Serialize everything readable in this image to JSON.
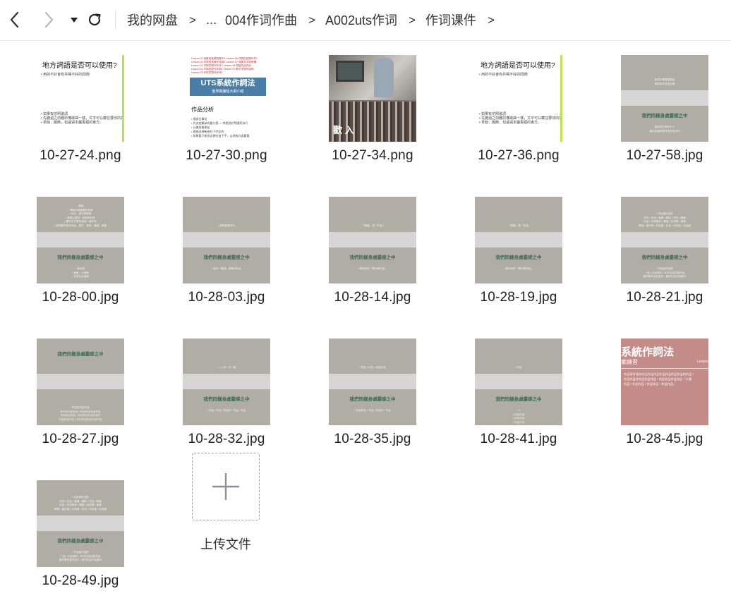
{
  "breadcrumb": {
    "items": [
      "我的网盘",
      "...",
      "004作词作曲",
      "A002uts作词",
      "作词课件"
    ],
    "separator": ">"
  },
  "files": [
    {
      "name": "10-27-24.png",
      "thumb": "slide",
      "title": "地方詞語是否可以使用?",
      "lines": [
        "• 用的不好會有共鳴不好的問題!",
        "• 如果有仿照歌詞",
        "  • 先聽過之前難的懂歌曲一樣，文字可以藏住要非的意思。",
        "  • 茶館，服飾，包遍週本屬風裡的東方。"
      ]
    },
    {
      "name": "10-27-30.png",
      "thumb": "uts",
      "red_lines": [
        "Lesson 01 為數的音樂詞音作1  Lesson 06 作詞的音樂作作2",
        "Lesson 02 作詞的音樂作作用2  Lesson 07 深層文字詞音構",
        "Lesson 03 字詞的詞作作作2  Lesson 08 詞彙作品作說",
        "Lesson 04 作詞的詞作作詞1  Lesson 09 歌中字詞作說詞",
        "Lesson 05 作詞的詞作作作1"
      ],
      "banner_title": "UTS系統作詞法",
      "banner_sub": "整學期課程大綱介紹",
      "section": "作品分析",
      "lines": [
        "• 描述出事出",
        "• 先決定類似的要什麼 -> 考慮對於等國家技巧",
        "• 以後找後朋友",
        "  • 歌曲出現新曲目下完全的",
        "  • 如果要下新思念想在這下手，以地為方面看看"
      ]
    },
    {
      "name": "10-27-34.png",
      "thumb": "photo",
      "caption": "歡 入"
    },
    {
      "name": "10-27-36.png",
      "thumb": "slide",
      "title": "地方詞語是否可以使用?",
      "lines": [
        "• 用的不好會有共鳴不好的問題!",
        "• 如果有仿照歌詞",
        "  • 先聽過之前難的懂歌曲一樣，文字可以藏住要非的意思。",
        "  • 茶館，服飾，包遍週本屬風裡的東方。"
      ]
    },
    {
      "name": "10-27-58.jpg",
      "thumb": "gray",
      "green": "我們同樣身處靈感之中",
      "green_pos": "low",
      "top_lines": [
        "我們不需要被限制",
        "獨寫者作品的目標"
      ],
      "bottom_lines": [
        "讓我們去寫作中介",
        "讓作品獲得寫作的作品中的"
      ]
    },
    {
      "name": "10-28-00.jpg",
      "thumb": "gray",
      "green": "我們同樣身處靈感之中",
      "green_pos": "low",
      "top_lines": [
        "• 開始",
        "• 開始的是都要你來過",
        "• 作品，是在哪裡寫",
        "• 要是主題在一個用到作品",
        "• 要在作什麼作品做一個作品",
        "• 我們要去寫作作品，是在、畫畫、轉換、轉變"
      ],
      "bottom_lines": [
        "• 給你說",
        "• 畫畫、什麼畫",
        "• 完成作品畫畫"
      ]
    },
    {
      "name": "10-28-03.jpg",
      "thumb": "gray",
      "green": "我們同樣身處靈感之中",
      "green_pos": "low",
      "top_lines": [
        "• 我們要寫的句"
      ],
      "bottom_lines": [
        "• 給你「看見」都寫作作品"
      ]
    },
    {
      "name": "10-28-14.jpg",
      "thumb": "gray",
      "green": "我們同樣身處靈感之中",
      "green_pos": "low",
      "top_lines": [
        "• 「寫著」是「作品」"
      ],
      "bottom_lines": [
        "• 寫作品的「寫作寫作品」"
      ]
    },
    {
      "name": "10-28-19.jpg",
      "thumb": "gray",
      "green": "我們同樣身處靈感之中",
      "green_pos": "low",
      "top_lines": [
        "• 「寫著」是「作品」"
      ],
      "bottom_lines": [
        "• 寫作品的「寫作寫作品」"
      ]
    },
    {
      "name": "10-28-21.jpg",
      "thumb": "gray",
      "green": "我們同樣身處靈感之中",
      "green_pos": "low",
      "top_lines": [
        "• 作品與作品的",
        "完成 • 作品 • 畫畫 • 轉換 • 作品 • 轉變",
        "作品 • 作品畫作 • 轉換 • 完成畫 • 畫畫",
        "轉換 • 畫作畫 • 作品畫 • 作品 • 作品畫 • 完成畫"
      ],
      "bottom_lines": [
        "• 作品給作品的",
        "一個 • 作品寫作 • 作作作品的寫作品",
        "要作寫作品作品作 • 寫作作品作品畫作"
      ]
    },
    {
      "name": "10-28-27.jpg",
      "thumb": "gray",
      "green": "我們同樣身處靈感之中",
      "green_pos": "high",
      "top_lines": [],
      "bottom_lines": [
        "作品的作品作品",
        "作作作作品作品 • 作品作品作品作品",
        "作品作品作品 • 作品作品作品作品作",
        "作品作品作品 • 作作作品作品作品作品"
      ]
    },
    {
      "name": "10-28-32.jpg",
      "thumb": "gray",
      "green": "我們同樣身處靈感之中",
      "green_pos": "low",
      "top_lines": [
        "• 人 • 作 • 作 • 轉"
      ],
      "bottom_lines": [
        "• 作品 • 作品 • 作品作 • 作品 • 作品"
      ]
    },
    {
      "name": "10-28-35.jpg",
      "thumb": "gray",
      "green": "我們同樣身處靈感之中",
      "green_pos": "low",
      "top_lines": [
        "• 作品 • 作品 • 作品作品"
      ],
      "bottom_lines": [
        "• 作品作品 • 作品 • 作品作 • 作品"
      ]
    },
    {
      "name": "10-28-41.jpg",
      "thumb": "gray",
      "green": "我們同樣身處靈感之中",
      "green_pos": "low",
      "top_lines": [
        "• 作品"
      ],
      "bottom_lines": [
        "• 人",
        "• 作品作品",
        "• 作品作品",
        "• 作品作品"
      ]
    },
    {
      "name": "10-28-45.jpg",
      "thumb": "pink",
      "title": "系統作詞法",
      "subtitle": "案練習",
      "lesson": "Lesson",
      "lines": [
        "作品寫作寫作作品作品作品作品作品作品作品的作品 •",
        "作品作品作作品作品作品 • 作品作品作品作品「人類",
        "作品 • 作品作品 • 作品作品 • 作品作品」"
      ]
    },
    {
      "name": "10-28-49.jpg",
      "thumb": "gray",
      "green": "我們同樣身處靈感之中",
      "green_pos": "low",
      "top_lines": [
        "• 作品與作品的",
        "完成 • 作品 • 畫畫 • 轉換 • 作品 • 轉變",
        "作品 • 作品畫作 • 轉換 • 完成畫 • 畫畫",
        "轉換 • 畫作畫 • 作品畫 • 作品 • 作品畫 • 完成畫"
      ],
      "bottom_lines": [
        "• 作品給作品的",
        "一個 • 作品寫作 • 作作作品的寫作品",
        "要作寫作品作品作 • 寫作作品作品畫作"
      ]
    }
  ],
  "upload": {
    "label": "上传文件"
  },
  "icons": {
    "back": "chevron-left-icon",
    "forward": "chevron-right-icon",
    "dropdown": "caret-down-icon",
    "refresh": "refresh-icon",
    "upload": "plus-icon"
  },
  "colors": {
    "slide_gray": "#b1aca4",
    "slide_stripe": "#d6d5d3",
    "slide_green": "#3c6b58",
    "slide_pink": "#c48c89",
    "uts_blue": "#4a7ea8"
  }
}
